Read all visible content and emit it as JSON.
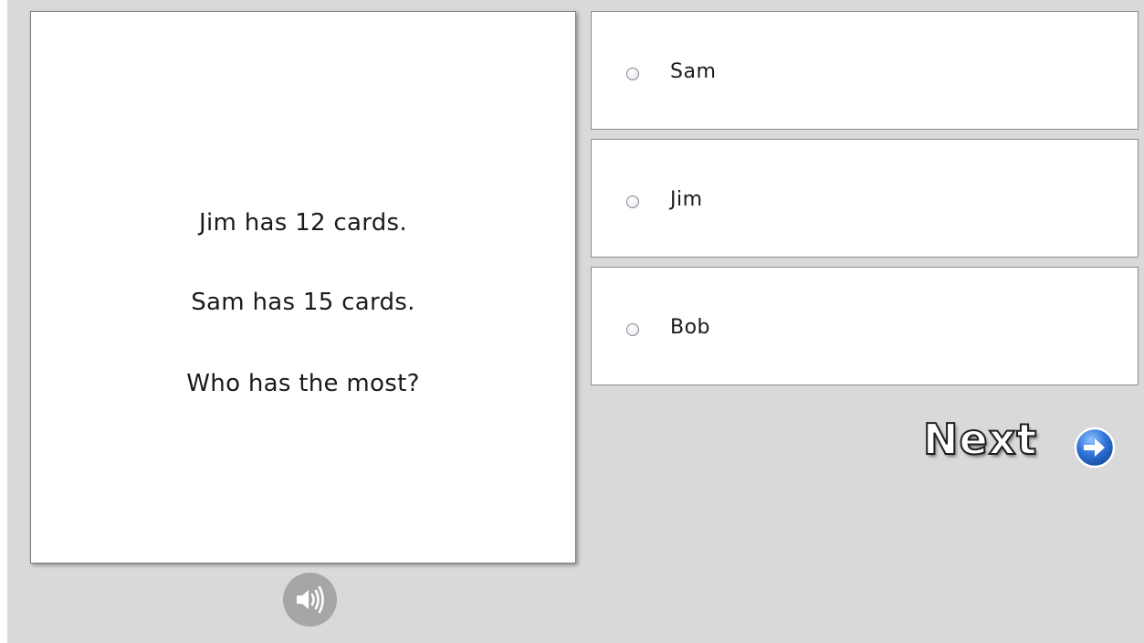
{
  "question": {
    "lines": [
      "Jim has 12 cards.",
      "Sam has 15 cards.",
      "Who has the most?"
    ]
  },
  "options": [
    {
      "label": "Sam",
      "selected": false
    },
    {
      "label": "Jim",
      "selected": false
    },
    {
      "label": "Bob",
      "selected": false
    }
  ],
  "controls": {
    "next_label": "Next",
    "audio_icon": "speaker-icon",
    "next_icon": "arrow-right-circle-icon"
  },
  "colors": {
    "background": "#d9d9d9",
    "card": "#ffffff",
    "speaker_button": "#a6a6a6",
    "next_arrow": "#2f74d6"
  }
}
